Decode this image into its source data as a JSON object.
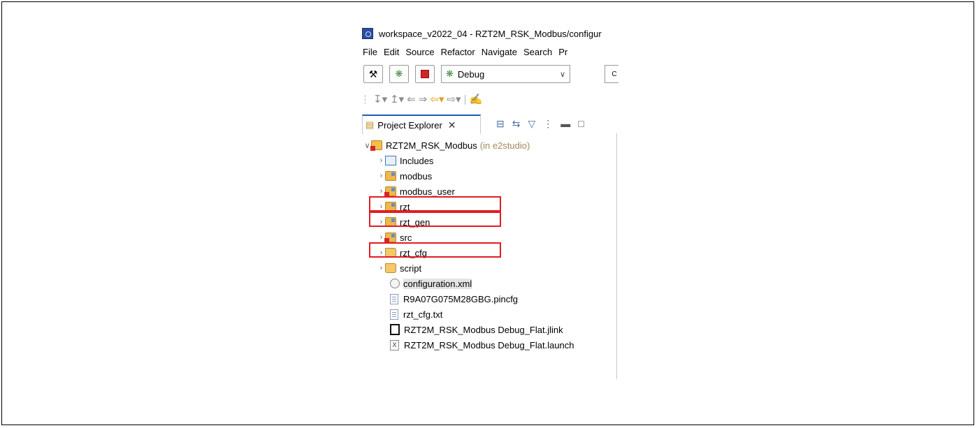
{
  "window": {
    "title": "workspace_v2022_04 - RZT2M_RSK_Modbus/configur"
  },
  "menu": {
    "items": [
      "File",
      "Edit",
      "Source",
      "Refactor",
      "Navigate",
      "Search",
      "Pr"
    ]
  },
  "toolbar": {
    "launch_config": "Debug",
    "c_label": "C"
  },
  "explorer": {
    "tab_label": "Project Explorer"
  },
  "tree": {
    "project": {
      "name": "RZT2M_RSK_Modbus",
      "annotation": "(in e2studio)"
    },
    "items": [
      {
        "label": "Includes"
      },
      {
        "label": "modbus"
      },
      {
        "label": "modbus_user"
      },
      {
        "label": "rzt"
      },
      {
        "label": "rzt_gen"
      },
      {
        "label": "src"
      },
      {
        "label": "rzt_cfg"
      },
      {
        "label": "script"
      },
      {
        "label": "configuration.xml"
      },
      {
        "label": "R9A07G075M28GBG.pincfg"
      },
      {
        "label": "rzt_cfg.txt"
      },
      {
        "label": "RZT2M_RSK_Modbus Debug_Flat.jlink"
      },
      {
        "label": "RZT2M_RSK_Modbus Debug_Flat.launch"
      }
    ]
  },
  "icons": {
    "app": "e2studio-icon",
    "build": "hammer-icon",
    "debug": "bug-icon",
    "stop": "stop-icon",
    "collapse_all": "collapse-all-icon",
    "link": "link-with-editor-icon",
    "filter": "filter-icon",
    "menu": "view-menu-icon",
    "minimize": "minimize-icon",
    "maximize": "maximize-icon"
  },
  "colors": {
    "highlight": "#e31b23",
    "annotation": "#a08a5a",
    "tab_accent": "#1c5fb0"
  }
}
